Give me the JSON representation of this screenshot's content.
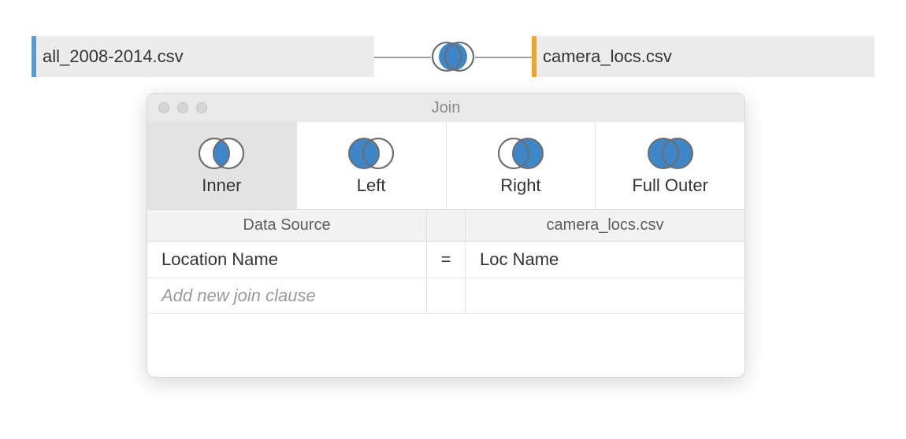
{
  "datasource": {
    "left_label": "all_2008-2014.csv",
    "right_label": "camera_locs.csv"
  },
  "join_panel": {
    "title": "Join",
    "types": {
      "inner": "Inner",
      "left": "Left",
      "right": "Right",
      "full": "Full Outer"
    },
    "header": {
      "left": "Data Source",
      "right": "camera_locs.csv"
    },
    "clauses": [
      {
        "left": "Location Name",
        "op": "=",
        "right": "Loc Name"
      }
    ],
    "add_placeholder": "Add new join clause"
  }
}
